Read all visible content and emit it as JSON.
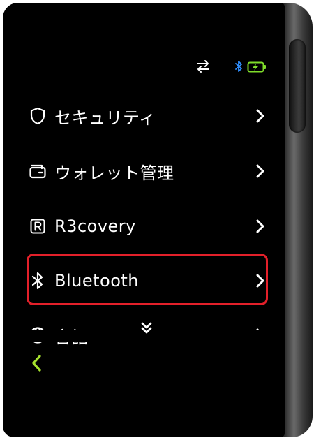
{
  "status": {
    "transfer_icon": "transfer-arrows-icon",
    "bluetooth_icon": "bluetooth-icon",
    "battery_icon": "battery-charging-icon",
    "bluetooth_color": "#2f8fff",
    "battery_color": "#7fdc2a"
  },
  "menu": {
    "items": [
      {
        "label": "セキュリティ",
        "icon": "shield-icon"
      },
      {
        "label": "ウォレット管理",
        "icon": "wallet-icon"
      },
      {
        "label": "R3covery",
        "icon": "recovery-r-icon"
      },
      {
        "label": "Bluetooth",
        "icon": "bluetooth-icon",
        "highlighted": true
      },
      {
        "label": "言語",
        "icon": "globe-icon"
      }
    ],
    "highlight_color": "#e3202a"
  },
  "navigation": {
    "more_icon": "double-chevron-down-icon",
    "back_icon": "back-arrow-icon",
    "back_color": "#a6e22e"
  }
}
